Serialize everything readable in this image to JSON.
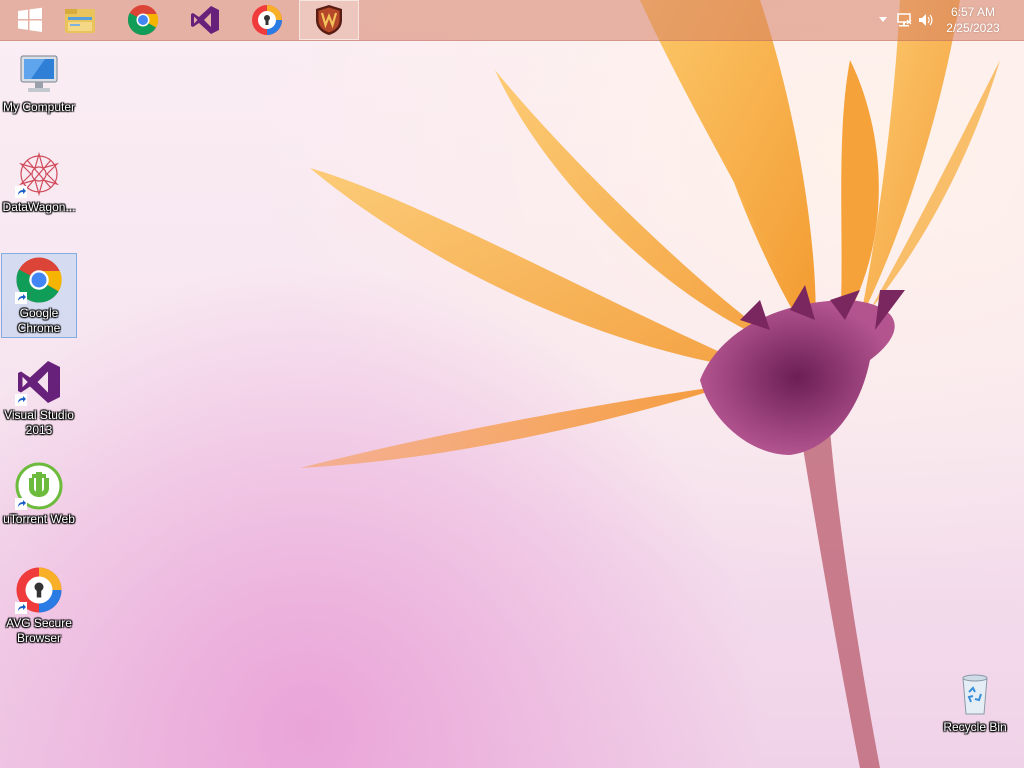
{
  "taskbar": {
    "pinned": [
      {
        "name": "start-button",
        "icon": "windows-logo-icon"
      },
      {
        "name": "file-explorer",
        "icon": "folder-icon"
      },
      {
        "name": "google-chrome",
        "icon": "chrome-icon"
      },
      {
        "name": "visual-studio",
        "icon": "visual-studio-icon"
      },
      {
        "name": "avg-secure-browser",
        "icon": "avg-browser-icon"
      },
      {
        "name": "datawagon",
        "icon": "shield-w-icon",
        "active": true
      }
    ],
    "tray": {
      "icons": [
        "chevron-up-icon",
        "network-icon",
        "volume-icon"
      ],
      "time": "6:57 AM",
      "date": "2/25/2023"
    }
  },
  "desktop": {
    "icons": [
      {
        "label": "My Computer",
        "icon": "computer-icon"
      },
      {
        "label": "DataWagon...",
        "icon": "datawagon-icon"
      },
      {
        "label": "Google Chrome",
        "icon": "chrome-icon",
        "selected": true
      },
      {
        "label": "Visual Studio 2013",
        "icon": "visual-studio-icon"
      },
      {
        "label": "uTorrent Web",
        "icon": "utorrent-icon"
      },
      {
        "label": "AVG Secure Browser",
        "icon": "avg-browser-icon"
      },
      {
        "label": "Recycle Bin",
        "icon": "recycle-bin-icon"
      }
    ]
  },
  "colors": {
    "taskbar": "#d68064",
    "petal": "#f7b24a",
    "flower_center": "#8a2f6e"
  }
}
